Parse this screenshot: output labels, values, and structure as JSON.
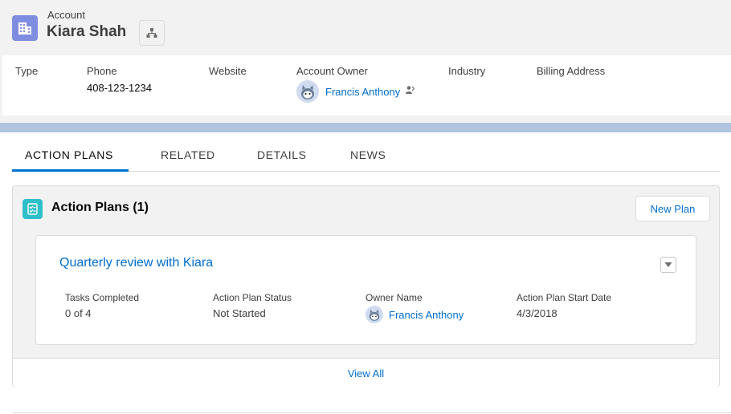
{
  "header": {
    "object_label": "Account",
    "record_name": "Kiara Shah",
    "icon": "account-building-icon",
    "hierarchy_icon": "hierarchy-icon"
  },
  "highlights": {
    "type_label": "Type",
    "phone_label": "Phone",
    "phone_value": "408-123-1234",
    "website_label": "Website",
    "owner_label": "Account Owner",
    "owner_value": "Francis Anthony",
    "industry_label": "Industry",
    "billing_label": "Billing Address"
  },
  "tabs": [
    {
      "label": "ACTION PLANS",
      "active": true
    },
    {
      "label": "RELATED",
      "active": false
    },
    {
      "label": "DETAILS",
      "active": false
    },
    {
      "label": "NEWS",
      "active": false
    }
  ],
  "card": {
    "title": "Action Plans (1)",
    "new_button": "New Plan",
    "footer_link": "View All",
    "plan": {
      "title": "Quarterly review with Kiara",
      "fields": [
        {
          "label": "Tasks Completed",
          "value": "0 of 4"
        },
        {
          "label": "Action Plan Status",
          "value": "Not Started"
        },
        {
          "label": "Owner Name",
          "value": "Francis Anthony"
        },
        {
          "label": "Action Plan Start Date",
          "value": "4/3/2018"
        }
      ]
    }
  },
  "colors": {
    "account_icon": "#7f8de1",
    "action_plan_icon": "#2fbfc9",
    "link": "#006dcc",
    "tab_active": "#0070d2",
    "band": "#b0c4df"
  }
}
